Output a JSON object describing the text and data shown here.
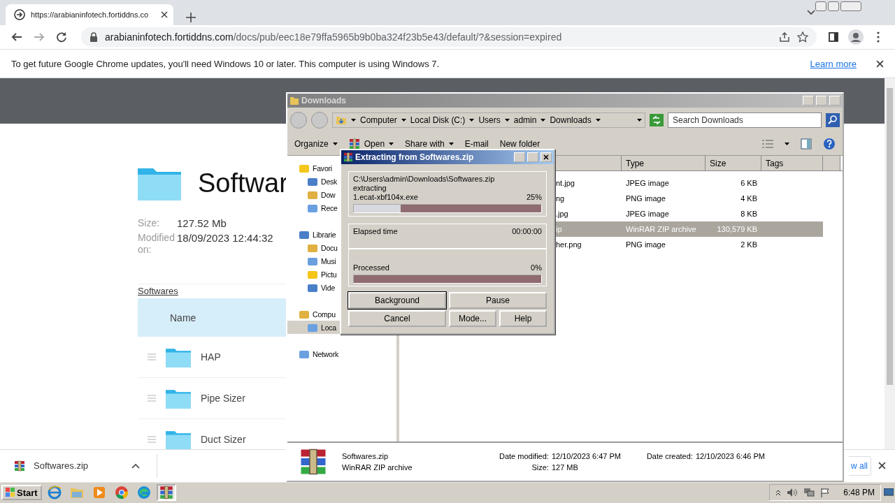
{
  "browser": {
    "tab": {
      "title": "https://arabianinfotech.fortiddns.co",
      "selected": true
    },
    "address": {
      "host": "arabianinfotech.fortiddns.com",
      "path": "/docs/pub/eec18e79ffa5965b9b0ba324f23b5e43/default/?&session=expired"
    },
    "infobar": {
      "message": "To get future Google Chrome updates, you'll need Windows 10 or later. This computer is using Windows 7.",
      "link": "Learn more"
    }
  },
  "page": {
    "title": "Softwar",
    "details": [
      {
        "label": "Size:",
        "value": "127.52 Mb"
      },
      {
        "label": "Modified on:",
        "value": "18/09/2023 12:44:32"
      }
    ],
    "breadcrumb": "Softwares",
    "table": {
      "columns": [
        "Name"
      ],
      "rows": [
        "HAP",
        "Pipe Sizer",
        "Duct Sizer"
      ]
    }
  },
  "downloads": {
    "file": "Softwares.zip",
    "show_all": "w all"
  },
  "explorer": {
    "title": "Downloads",
    "breadcrumbs": [
      "Computer",
      "Local Disk (C:)",
      "Users",
      "admin",
      "Downloads"
    ],
    "search": {
      "placeholder": "Search Downloads"
    },
    "toolbar": [
      {
        "label": "Organize",
        "dropdown": true
      },
      {
        "label": "Open",
        "dropdown": true
      },
      {
        "label": "Share with",
        "dropdown": true
      },
      {
        "label": "E-mail",
        "dropdown": false
      },
      {
        "label": "New folder",
        "dropdown": false
      }
    ],
    "nav": [
      {
        "label": "Favori",
        "selected": false,
        "children": [
          {
            "label": "Desk",
            "selected": false
          },
          {
            "label": "Dow",
            "selected": false
          },
          {
            "label": "Rece",
            "selected": false
          }
        ]
      },
      {
        "label": "Librarie",
        "selected": false,
        "children": [
          {
            "label": "Docu",
            "selected": false
          },
          {
            "label": "Musi",
            "selected": false
          },
          {
            "label": "Pictu",
            "selected": false
          },
          {
            "label": "Vide",
            "selected": false
          }
        ]
      },
      {
        "label": "Compu",
        "selected": false,
        "children": [
          {
            "label": "Loca",
            "selected": true
          }
        ]
      },
      {
        "label": "Network",
        "selected": false
      }
    ],
    "columns": [
      "Type",
      "Size",
      "Tags"
    ],
    "files": [
      {
        "name": "nt.jpg",
        "type": "JPEG image",
        "size": "6 KB",
        "selected": false
      },
      {
        "name": "ng",
        "type": "PNG image",
        "size": "4 KB",
        "selected": false
      },
      {
        "name": ".jpg",
        "type": "JPEG image",
        "size": "8 KB",
        "selected": false
      },
      {
        "name": "ip",
        "type": "WinRAR ZIP archive",
        "size": "130,579 KB",
        "selected": true
      },
      {
        "name": "her.png",
        "type": "PNG image",
        "size": "2 KB",
        "selected": false
      }
    ],
    "details": {
      "name": "Softwares.zip",
      "type": "WinRAR ZIP archive",
      "fields": [
        {
          "label": "Date modified:",
          "value": "12/10/2023 6:47 PM"
        },
        {
          "label": "Date created:",
          "value": "12/10/2023 6:46 PM"
        },
        {
          "label": "Size:",
          "value": "127 MB"
        }
      ]
    }
  },
  "dialog": {
    "title": "Extracting from Softwares.zip",
    "archive": "C:\\Users\\admin\\Downloads\\Softwares.zip",
    "action": "extracting",
    "file": "1.ecat-xbf104x.exe",
    "file_percent": "25%",
    "file_progress": {
      "level": 0.25
    },
    "elapsed": {
      "label": "Elapsed time",
      "value": "00:00:00"
    },
    "processed": {
      "label": "Processed",
      "value": "0%",
      "level": 0
    },
    "buttons": [
      {
        "label": "Background",
        "focused": true
      },
      {
        "label": "Pause",
        "focused": false
      },
      {
        "label": "Cancel",
        "focused": false
      },
      {
        "label": "Mode...",
        "focused": false
      },
      {
        "label": "Help",
        "focused": false
      }
    ]
  },
  "taskbar": {
    "start": "Start",
    "apps": [
      {
        "selected": false
      },
      {
        "selected": false
      },
      {
        "selected": false
      },
      {
        "selected": false
      },
      {
        "selected": false
      },
      {
        "selected": true
      }
    ],
    "clock": "6:48 PM"
  }
}
